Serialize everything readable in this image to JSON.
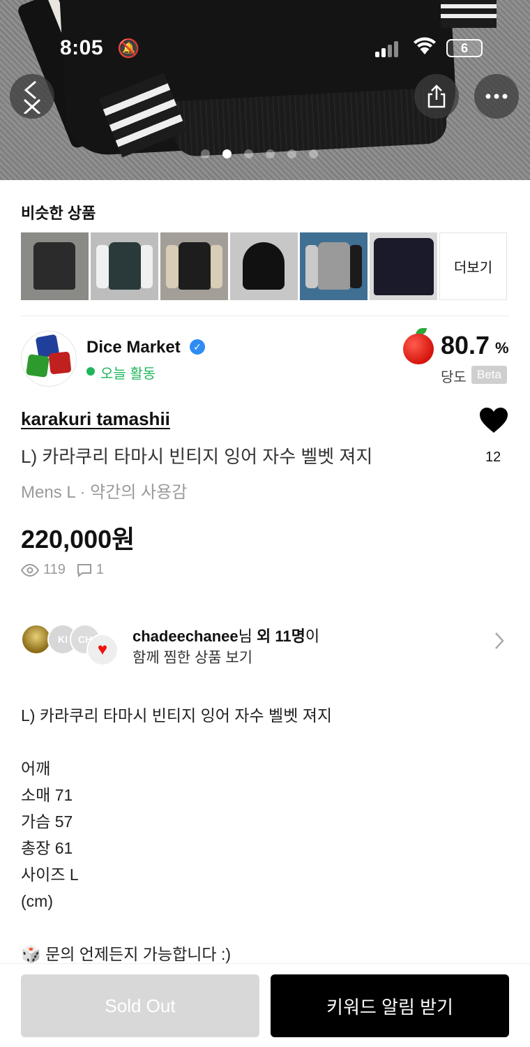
{
  "status_bar": {
    "time": "8:05",
    "battery": "6"
  },
  "hero": {
    "page_count": 6,
    "active_index": 1
  },
  "similar": {
    "title": "비슷한 상품",
    "more_label": "더보기"
  },
  "seller": {
    "name": "Dice Market",
    "activity": "오늘 활동",
    "score": "80.7",
    "score_unit": "%",
    "score_label": "당도",
    "beta_label": "Beta"
  },
  "product": {
    "brand": "karakuri tamashii",
    "title": "L) 카라쿠리 타마시 빈티지 잉어 자수 벨벳 져지",
    "meta": "Mens L · 약간의 사용감",
    "price": "220,000원",
    "likes": "12",
    "views": "119",
    "comments": "1"
  },
  "likers": {
    "first_user": "chadeechanee",
    "suffix_nim": "님 ",
    "others": "외 11명",
    "suffix_i": "이",
    "subtitle": "함께 찜한 상품 보기",
    "avatar_initials": [
      "KI",
      "CH"
    ]
  },
  "description": {
    "lines": [
      "L) 카라쿠리 타마시 빈티지 잉어 자수 벨벳 져지",
      "",
      "어깨",
      "소매 71",
      "가슴 57",
      "총장 61",
      "사이즈 L",
      "(cm)",
      "",
      "🎲 문의 언제든지 가능합니다 :)"
    ]
  },
  "bottom": {
    "sold_label": "Sold Out",
    "alert_label": "키워드 알림 받기"
  },
  "colors": {
    "active_green": "#20b55a",
    "verified_blue": "#2f8cf3",
    "cta_black": "#000000",
    "sold_gray": "#d8d8d8"
  }
}
